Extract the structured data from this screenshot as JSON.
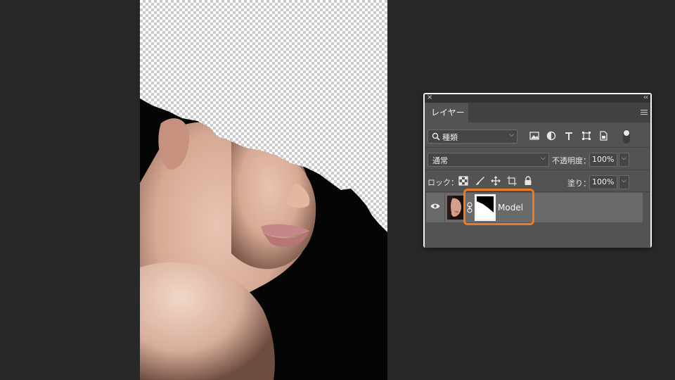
{
  "canvas": {
    "layer_name": "Model"
  },
  "panel": {
    "close_glyph": "×",
    "collapse_glyph": "‹‹",
    "tab_label": "レイヤー",
    "menu_icon": "hamburger-menu-icon",
    "filter": {
      "kind_label": "種類",
      "icons": [
        "image-filter-icon",
        "adjustment-filter-icon",
        "type-filter-icon",
        "shape-filter-icon",
        "smart-object-filter-icon"
      ]
    },
    "blend": {
      "mode": "通常",
      "opacity_label": "不透明度：",
      "opacity_value": "100%"
    },
    "lock": {
      "label": "ロック：",
      "icons": [
        "lock-transparent-icon",
        "lock-image-icon",
        "lock-position-icon",
        "lock-artboard-icon",
        "lock-all-icon"
      ],
      "fill_label": "塗り：",
      "fill_value": "100%"
    },
    "layer": {
      "name": "Model",
      "visible": true
    }
  },
  "colors": {
    "highlight": "#f07a22",
    "panel_bg": "#535353",
    "app_bg": "#282828"
  }
}
